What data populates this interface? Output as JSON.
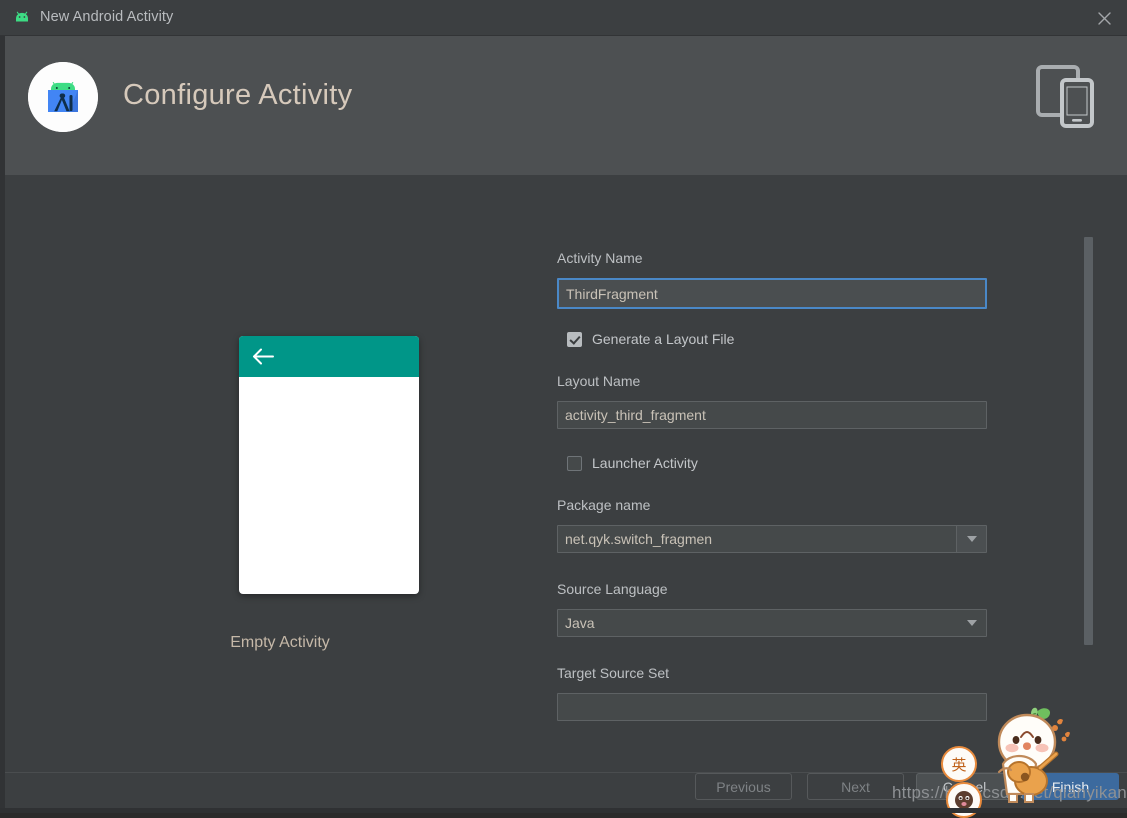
{
  "window": {
    "title": "New Android Activity",
    "app_icon": "android-robot-icon",
    "close_icon": "close-icon"
  },
  "header": {
    "title": "Configure Activity",
    "logo_icon": "android-studio-logo-icon",
    "device_icon": "tablet-and-phone-icon"
  },
  "preview": {
    "caption": "Empty Activity",
    "appbar_color": "#009688",
    "back_icon": "arrow-back-icon"
  },
  "form": {
    "activity_name": {
      "label": "Activity Name",
      "value": "ThirdFragment",
      "focused": true
    },
    "generate_layout": {
      "label": "Generate a Layout File",
      "checked": true
    },
    "layout_name": {
      "label": "Layout Name",
      "value": "activity_third_fragment"
    },
    "launcher_activity": {
      "label": "Launcher Activity",
      "checked": false
    },
    "package_name": {
      "label": "Package name",
      "value": "net.qyk.switch_fragmen",
      "dropdown_icon": "chevron-down-icon"
    },
    "source_language": {
      "label": "Source Language",
      "value": "Java",
      "dropdown_icon": "chevron-down-icon"
    },
    "target_source_set": {
      "label": "Target Source Set",
      "value": ""
    }
  },
  "footer": {
    "previous": "Previous",
    "next": "Next",
    "cancel": "Cancel",
    "finish": "Finish",
    "accent_color": "#3c6a9e"
  },
  "overlay": {
    "watermark": "https://blog.csdn.net/qianyikang",
    "ime_badge": "英",
    "sticker_icon": "mascot-guitar-sticker"
  }
}
